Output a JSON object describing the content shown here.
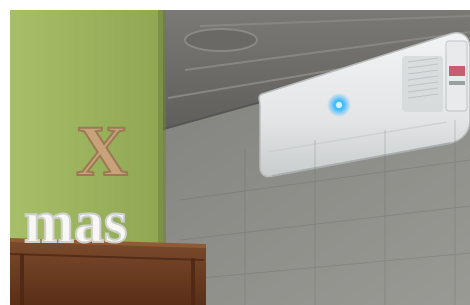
{
  "photo": {
    "subjects": [
      "x-mas-letter-sign",
      "wall-mounted-air-conditioner",
      "wooden-shelf",
      "ceiling-light"
    ],
    "sign": {
      "top_letter": "X",
      "bottom_word": "mas"
    },
    "colors": {
      "green_wall": "#a9c06a",
      "green_wall_shadow": "#8fa653",
      "grey_wall": "#8a8a85",
      "ceiling": "#6f6e6a",
      "ac_body": "#e7e9ea",
      "ac_led": "#39b8ff",
      "shelf_wood": "#6b3b20",
      "sign_wood": "#c7a27a",
      "sign_white": "#f7f7f5"
    }
  }
}
